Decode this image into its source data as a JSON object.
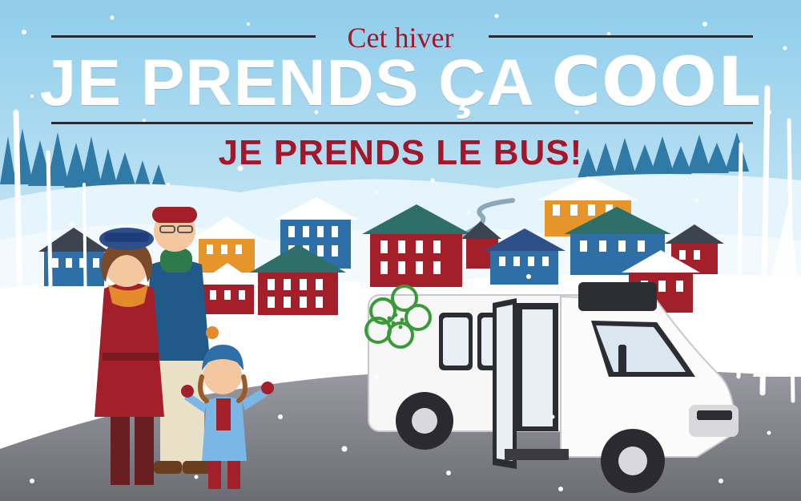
{
  "headline": {
    "kicker": "Cet hiver",
    "main_prefix": "JE PRENDS ÇA ",
    "main_emphasis": "COOL",
    "sub": "JE PRENDS LE BUS!"
  },
  "colors": {
    "sky": "#cfe8f5",
    "headline_red": "#a3172a",
    "headline_white": "#ffffff",
    "road": "#8c8c93",
    "bus_body": "#f7f7f7",
    "logo_green": "#3a9a3a"
  },
  "icons": [
    "flower-logo-icon",
    "snowflake-icon"
  ]
}
